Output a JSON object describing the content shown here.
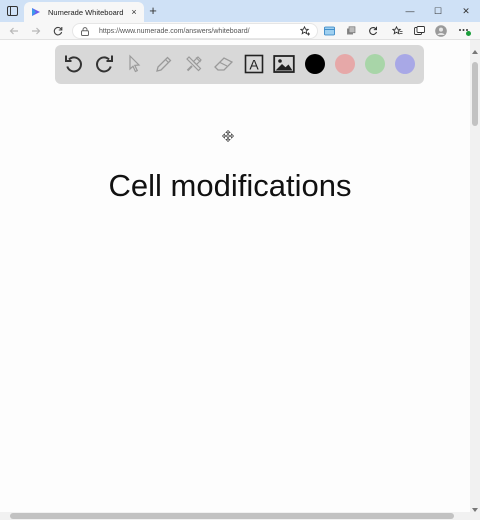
{
  "browser": {
    "tab": {
      "title": "Numerade Whiteboard",
      "close_glyph": "×"
    },
    "new_tab_glyph": "+",
    "window_controls": {
      "minimize": "—",
      "maximize": "☐",
      "close": "✕"
    },
    "address_bar": {
      "url": "https://www.numerade.com/answers/whiteboard/"
    },
    "icons": [
      "tab-actions-icon",
      "back-icon",
      "forward-icon",
      "refresh-icon",
      "lock-icon",
      "add-favorite-icon",
      "extension-icon",
      "collections-icon",
      "sync-icon",
      "favorites-icon",
      "split-screen-icon",
      "profile-icon",
      "more-icon"
    ]
  },
  "whiteboard": {
    "tools": [
      "undo-icon",
      "redo-icon",
      "pointer-icon",
      "pencil-icon",
      "tools-icon",
      "eraser-icon",
      "text-icon",
      "image-icon"
    ],
    "text_tool_letter": "A",
    "colors": [
      "#000000",
      "#e6a8a8",
      "#a8d5a8",
      "#a8a8e6"
    ],
    "accent": "#d8d8d8",
    "heading": "Cell modifications"
  }
}
